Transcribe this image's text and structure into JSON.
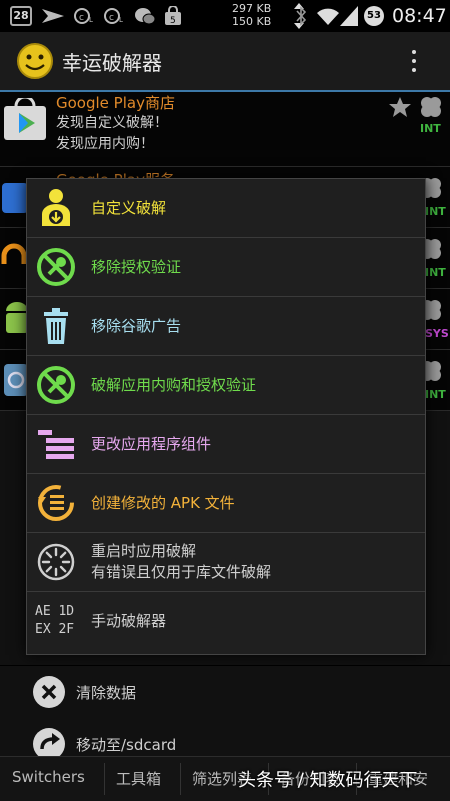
{
  "status_bar": {
    "calendar_day": "28",
    "upload_speed": "297 KB",
    "download_speed": "150 KB",
    "battery_level": "53",
    "time": "08:47"
  },
  "action_bar": {
    "title": "幸运破解器"
  },
  "background_list": {
    "rows": [
      {
        "title": "Google Play商店",
        "line1": "发现自定义破解！",
        "line2": "发现应用内购！",
        "badge": "INT"
      },
      {
        "title": "Google Play服务",
        "badge": "INT"
      },
      {
        "badge": "INT"
      },
      {
        "badge": "SYS"
      },
      {
        "badge": "INT"
      }
    ]
  },
  "dialog": {
    "items": [
      {
        "label": "自定义破解",
        "color": "#f2e23a",
        "icon": "custom-patch-icon"
      },
      {
        "label": "移除授权验证",
        "color": "#6fdb4c",
        "icon": "remove-license-icon"
      },
      {
        "label": "移除谷歌广告",
        "color": "#a8dff0",
        "icon": "trash-icon"
      },
      {
        "label": "破解应用内购和授权验证",
        "color": "#6fdb4c",
        "icon": "iap-license-icon"
      },
      {
        "label": "更改应用程序组件",
        "color": "#e6a8ee",
        "icon": "components-icon"
      },
      {
        "label": "创建修改的 APK 文件",
        "color": "#f3b23a",
        "icon": "apk-icon"
      },
      {
        "label": "重启时应用破解",
        "label2": "有错误且仅用于库文件破解",
        "color": "#d0d0d0",
        "icon": "reboot-spinner-icon"
      },
      {
        "label": "手动破解器",
        "color": "#d0d0d0",
        "icon": "manual-patcher-icon",
        "icon_text1": "AE 1D",
        "icon_text2": "EX 2F"
      }
    ]
  },
  "bottom_items": [
    {
      "label": "清除数据",
      "icon": "clear-data-icon"
    },
    {
      "label": "移动至/sdcard",
      "icon": "move-sdcard-icon"
    }
  ],
  "bottom_tabs": [
    "Switchers",
    "工具箱",
    "筛选列表",
    "备份列表",
    "重建和安"
  ],
  "watermark": "头条号 / 知数码行天下"
}
